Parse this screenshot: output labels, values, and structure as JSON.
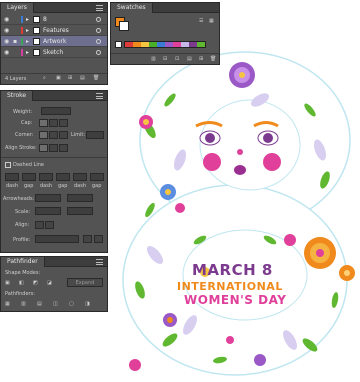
{
  "layers": {
    "tab": "Layers",
    "rows": [
      {
        "name": "8",
        "color": "#3a7bd5"
      },
      {
        "name": "Features",
        "color": "#e03b3b"
      },
      {
        "name": "Artwork",
        "color": "#3aa655"
      },
      {
        "name": "Sketch",
        "color": "#d63fa0"
      }
    ],
    "footer": "4 Layers"
  },
  "swatches": {
    "tab": "Swatches",
    "none_label": "None"
  },
  "stroke": {
    "tab": "Stroke",
    "weight_label": "Weight:",
    "cap_label": "Cap:",
    "corner_label": "Corner:",
    "limit_label": "Limit:",
    "align_label": "Align Stroke:",
    "dashed_label": "Dashed Line",
    "dash_labels": [
      "dash",
      "gap",
      "dash",
      "gap",
      "dash",
      "gap"
    ],
    "arrow_label": "Arrowheads:",
    "scale_label": "Scale:",
    "align2_label": "Align:",
    "profile_label": "Profile:"
  },
  "pathfinder": {
    "tab": "Pathfinder",
    "shape_label": "Shape Modes:",
    "expand_label": "Expand",
    "path_label": "Pathfinders:"
  },
  "artwork": {
    "line1": "MARCH 8",
    "line2": "INTERNATIONAL",
    "line3": "WOMEN'S DAY",
    "colors": {
      "purple": "#7c3a8f",
      "orange": "#f08a1c",
      "pink": "#e0409a",
      "green": "#4caf2a",
      "lilac": "#c7b8e8"
    }
  }
}
